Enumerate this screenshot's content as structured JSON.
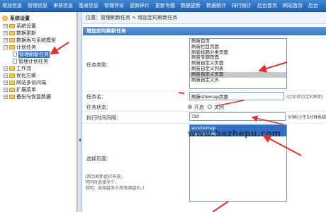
{
  "topnav": {
    "items": [
      "增加信息",
      "管理信息",
      "审核信息",
      "签发信息",
      "管理评论",
      "更新碎片",
      "更新专题",
      "数据更新",
      "数据统计",
      "排行统计",
      "后台首页",
      "网站首页",
      "后台"
    ]
  },
  "sidebar": {
    "root": "系统设置",
    "items": [
      {
        "label": "系统设置"
      },
      {
        "label": "数据更新"
      },
      {
        "label": "数据表与系统模型"
      },
      {
        "label": "计划任务"
      },
      {
        "label": "管理刷新任务"
      },
      {
        "label": "管理计划任务"
      },
      {
        "label": "工作流"
      },
      {
        "label": "优化方案"
      },
      {
        "label": "网站多访问端"
      },
      {
        "label": "扩展菜单"
      },
      {
        "label": "备份与恢复数据"
      }
    ]
  },
  "breadcrumb": "位置：管理刷新任务 > 增加定时刷新任务",
  "panel_title": "增加定时刷新任务",
  "form": {
    "type_label": "任务类型：",
    "type_options": [
      "刷新首页",
      "刷新栏目页面",
      "刷新标题分类页面",
      "刷新专题页面",
      "刷新自定义页面",
      "刷新自定义列表",
      "刷新自定义页面",
      "刷新自定义JS"
    ],
    "type_selected_index": 6,
    "name_label": "任务名：",
    "name_value": "刷新sitemap页面",
    "name_hint": "(比如首页定时刷新)",
    "status_label": "任务状态：",
    "status_on": "开启",
    "status_off": "关闭",
    "interval_label": "执行时间间隔：",
    "interval_value": "720",
    "interval_unit": "分钟(小于5分钟系统)",
    "page_label": "选择页面：",
    "page_options": [
      "wzsitemap",
      "tagsitemap"
    ],
    "note1": "(首页刷新此栏失效，",
    "note2": "可同时选择多个，",
    "note3": "说明：选择越多占用资源越大。)"
  },
  "watermark": "www.bazhepu.com",
  "colors": {
    "nav": "#2f72c4",
    "selected": "#2f6fc8",
    "arrow": "#e0312d"
  }
}
